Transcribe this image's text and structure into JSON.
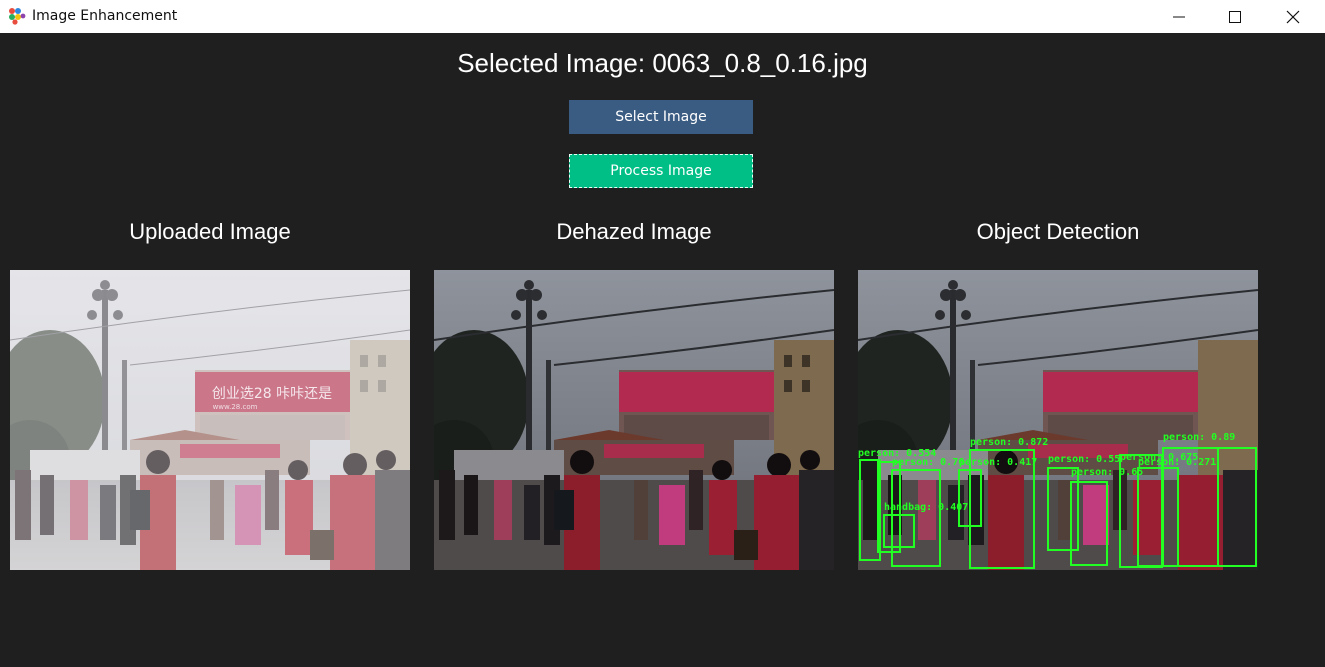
{
  "window": {
    "title": "Image Enhancement",
    "controls": [
      "minimize",
      "maximize",
      "close"
    ]
  },
  "header": {
    "selected_image": "Selected Image: 0063_0.8_0.16.jpg"
  },
  "buttons": {
    "select_label": "Select Image",
    "process_label": "Process Image"
  },
  "panels": {
    "uploaded_title": "Uploaded Image",
    "dehazed_title": "Dehazed Image",
    "detection_title": "Object Detection"
  },
  "colors": {
    "background": "#1f1f1f",
    "select_button": "#3a5b82",
    "process_button": "#00bf86",
    "detection_box": "#22ff22"
  },
  "signage": {
    "billboard": "创业选28 咔咔还是",
    "billboard_sub": "www.28.com"
  },
  "detections": [
    {
      "label": "person: 0.872"
    },
    {
      "label": "person: 0.417"
    },
    {
      "label": "person: 0.76"
    },
    {
      "label": "handbag: 0.407"
    },
    {
      "label": "person: 0.55"
    },
    {
      "label": "person: 0.65"
    },
    {
      "label": "person: 0.675"
    },
    {
      "label": "person: 0.271"
    },
    {
      "label": "person: 0.89"
    },
    {
      "label": "person: 0.554"
    }
  ]
}
